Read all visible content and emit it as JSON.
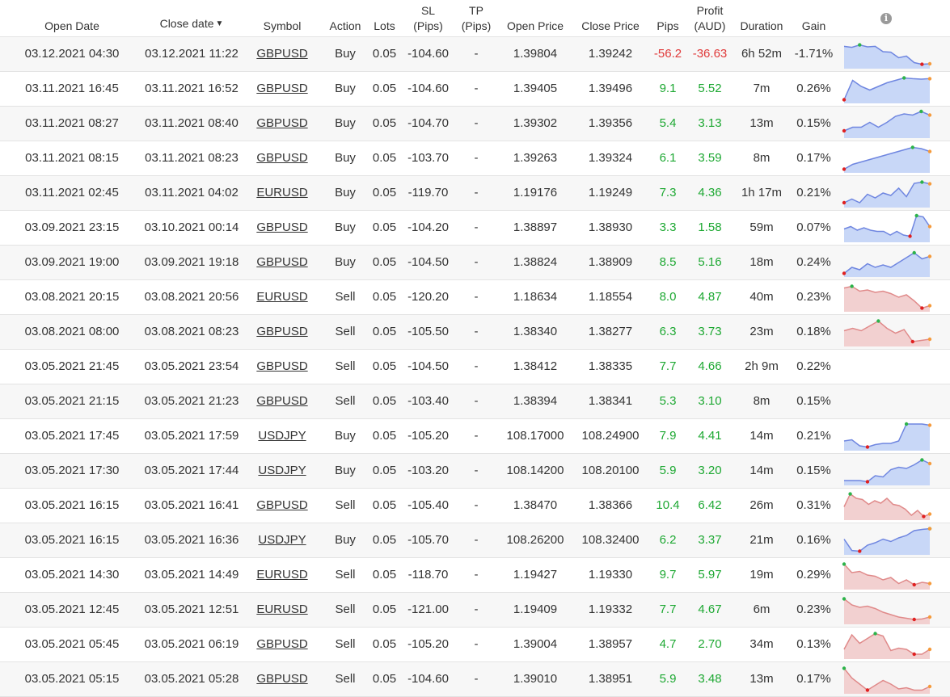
{
  "columns": {
    "open_date": "Open Date",
    "close_date": "Close date",
    "sort_indicator": "▼",
    "symbol": "Symbol",
    "action": "Action",
    "lots": "Lots",
    "sl_1": "SL",
    "sl_2": "(Pips)",
    "tp_1": "TP",
    "tp_2": "(Pips)",
    "open_price": "Open Price",
    "close_price": "Close Price",
    "pips": "Pips",
    "profit_1": "Profit",
    "profit_2": "(AUD)",
    "duration": "Duration",
    "gain": "Gain",
    "info_icon": "i"
  },
  "colors": {
    "positive": "#1da832",
    "negative": "#e03a3a",
    "buy_fill": "#c8d7f7",
    "buy_line": "#6f86e0",
    "sell_fill": "#f2d0d0",
    "sell_line": "#e08a8a",
    "high_dot": "#2cb34a",
    "low_dot": "#e02020",
    "end_dot": "#f59a3b"
  },
  "trades": [
    {
      "open": "03.12.2021 04:30",
      "close": "03.12.2021 11:22",
      "symbol": "GBPUSD",
      "action": "Buy",
      "lots": "0.05",
      "sl": "-104.60",
      "tp": "-",
      "open_price": "1.39804",
      "close_price": "1.39242",
      "pips": "-56.2",
      "profit": "-36.63",
      "duration": "6h 52m",
      "gain": "-1.71%",
      "chart": [
        0.82,
        0.78,
        0.88,
        0.8,
        0.82,
        0.6,
        0.58,
        0.35,
        0.42,
        0.15,
        0.08,
        0.1
      ]
    },
    {
      "open": "03.11.2021 16:45",
      "close": "03.11.2021 16:52",
      "symbol": "GBPUSD",
      "action": "Buy",
      "lots": "0.05",
      "sl": "-104.60",
      "tp": "-",
      "open_price": "1.39405",
      "close_price": "1.39496",
      "pips": "9.1",
      "profit": "5.52",
      "duration": "7m",
      "gain": "0.26%",
      "chart": [
        0.05,
        0.85,
        0.6,
        0.45,
        0.6,
        0.75,
        0.85,
        0.95,
        0.92,
        0.9,
        0.92
      ]
    },
    {
      "open": "03.11.2021 08:27",
      "close": "03.11.2021 08:40",
      "symbol": "GBPUSD",
      "action": "Buy",
      "lots": "0.05",
      "sl": "-104.70",
      "tp": "-",
      "open_price": "1.39302",
      "close_price": "1.39356",
      "pips": "5.4",
      "profit": "3.13",
      "duration": "13m",
      "gain": "0.15%",
      "chart": [
        0.2,
        0.35,
        0.35,
        0.55,
        0.35,
        0.55,
        0.8,
        0.9,
        0.85,
        1.0,
        0.85
      ]
    },
    {
      "open": "03.11.2021 08:15",
      "close": "03.11.2021 08:23",
      "symbol": "GBPUSD",
      "action": "Buy",
      "lots": "0.05",
      "sl": "-103.70",
      "tp": "-",
      "open_price": "1.39263",
      "close_price": "1.39324",
      "pips": "6.1",
      "profit": "3.59",
      "duration": "8m",
      "gain": "0.17%",
      "chart": [
        0.05,
        0.25,
        0.35,
        0.45,
        0.55,
        0.65,
        0.75,
        0.85,
        0.95,
        0.9,
        0.78
      ]
    },
    {
      "open": "03.11.2021 02:45",
      "close": "03.11.2021 04:02",
      "symbol": "EURUSD",
      "action": "Buy",
      "lots": "0.05",
      "sl": "-119.70",
      "tp": "-",
      "open_price": "1.19176",
      "close_price": "1.19249",
      "pips": "7.3",
      "profit": "4.36",
      "duration": "1h 17m",
      "gain": "0.21%",
      "chart": [
        0.1,
        0.25,
        0.1,
        0.45,
        0.3,
        0.5,
        0.4,
        0.7,
        0.35,
        0.9,
        0.95,
        0.88
      ]
    },
    {
      "open": "03.09.2021 23:15",
      "close": "03.10.2021 00:14",
      "symbol": "GBPUSD",
      "action": "Buy",
      "lots": "0.05",
      "sl": "-104.20",
      "tp": "-",
      "open_price": "1.38897",
      "close_price": "1.38930",
      "pips": "3.3",
      "profit": "1.58",
      "duration": "59m",
      "gain": "0.07%",
      "chart": [
        0.45,
        0.55,
        0.4,
        0.5,
        0.4,
        0.35,
        0.35,
        0.2,
        0.35,
        0.2,
        0.15,
        1.0,
        0.95,
        0.55
      ]
    },
    {
      "open": "03.09.2021 19:00",
      "close": "03.09.2021 19:18",
      "symbol": "GBPUSD",
      "action": "Buy",
      "lots": "0.05",
      "sl": "-104.50",
      "tp": "-",
      "open_price": "1.38824",
      "close_price": "1.38909",
      "pips": "8.5",
      "profit": "5.16",
      "duration": "18m",
      "gain": "0.24%",
      "chart": [
        0.05,
        0.3,
        0.2,
        0.45,
        0.3,
        0.4,
        0.3,
        0.5,
        0.7,
        0.9,
        0.65,
        0.75
      ]
    },
    {
      "open": "03.08.2021 20:15",
      "close": "03.08.2021 20:56",
      "symbol": "EURUSD",
      "action": "Sell",
      "lots": "0.05",
      "sl": "-120.20",
      "tp": "-",
      "open_price": "1.18634",
      "close_price": "1.18554",
      "pips": "8.0",
      "profit": "4.87",
      "duration": "40m",
      "gain": "0.23%",
      "chart": [
        0.88,
        0.95,
        0.75,
        0.8,
        0.7,
        0.75,
        0.65,
        0.5,
        0.6,
        0.35,
        0.05,
        0.15
      ]
    },
    {
      "open": "03.08.2021 08:00",
      "close": "03.08.2021 08:23",
      "symbol": "GBPUSD",
      "action": "Sell",
      "lots": "0.05",
      "sl": "-105.50",
      "tp": "-",
      "open_price": "1.38340",
      "close_price": "1.38277",
      "pips": "6.3",
      "profit": "3.73",
      "duration": "23m",
      "gain": "0.18%",
      "chart": [
        0.55,
        0.65,
        0.55,
        0.75,
        0.95,
        0.65,
        0.45,
        0.6,
        0.1,
        0.15,
        0.2
      ]
    },
    {
      "open": "03.05.2021 21:45",
      "close": "03.05.2021 23:54",
      "symbol": "GBPUSD",
      "action": "Sell",
      "lots": "0.05",
      "sl": "-104.50",
      "tp": "-",
      "open_price": "1.38412",
      "close_price": "1.38335",
      "pips": "7.7",
      "profit": "4.66",
      "duration": "2h 9m",
      "gain": "0.22%",
      "chart": []
    },
    {
      "open": "03.05.2021 21:15",
      "close": "03.05.2021 21:23",
      "symbol": "GBPUSD",
      "action": "Sell",
      "lots": "0.05",
      "sl": "-103.40",
      "tp": "-",
      "open_price": "1.38394",
      "close_price": "1.38341",
      "pips": "5.3",
      "profit": "3.10",
      "duration": "8m",
      "gain": "0.15%",
      "chart": []
    },
    {
      "open": "03.05.2021 17:45",
      "close": "03.05.2021 17:59",
      "symbol": "USDJPY",
      "action": "Buy",
      "lots": "0.05",
      "sl": "-105.20",
      "tp": "-",
      "open_price": "108.17000",
      "close_price": "108.24900",
      "pips": "7.9",
      "profit": "4.41",
      "duration": "14m",
      "gain": "0.21%",
      "chart": [
        0.3,
        0.35,
        0.1,
        0.05,
        0.15,
        0.2,
        0.2,
        0.3,
        1.0,
        1.0,
        1.0,
        0.95
      ]
    },
    {
      "open": "03.05.2021 17:30",
      "close": "03.05.2021 17:44",
      "symbol": "USDJPY",
      "action": "Buy",
      "lots": "0.05",
      "sl": "-103.20",
      "tp": "-",
      "open_price": "108.14200",
      "close_price": "108.20100",
      "pips": "5.9",
      "profit": "3.20",
      "duration": "14m",
      "gain": "0.15%",
      "chart": [
        0.1,
        0.1,
        0.1,
        0.05,
        0.3,
        0.25,
        0.55,
        0.65,
        0.6,
        0.75,
        0.95,
        0.8
      ]
    },
    {
      "open": "03.05.2021 16:15",
      "close": "03.05.2021 16:41",
      "symbol": "GBPUSD",
      "action": "Sell",
      "lots": "0.05",
      "sl": "-105.40",
      "tp": "-",
      "open_price": "1.38470",
      "close_price": "1.38366",
      "pips": "10.4",
      "profit": "6.42",
      "duration": "26m",
      "gain": "0.31%",
      "chart": [
        0.45,
        0.98,
        0.8,
        0.75,
        0.55,
        0.7,
        0.6,
        0.8,
        0.55,
        0.5,
        0.35,
        0.1,
        0.3,
        0.05,
        0.15
      ]
    },
    {
      "open": "03.05.2021 16:15",
      "close": "03.05.2021 16:36",
      "symbol": "USDJPY",
      "action": "Buy",
      "lots": "0.05",
      "sl": "-105.70",
      "tp": "-",
      "open_price": "108.26200",
      "close_price": "108.32400",
      "pips": "6.2",
      "profit": "3.37",
      "duration": "21m",
      "gain": "0.16%",
      "chart": [
        0.55,
        0.08,
        0.05,
        0.3,
        0.4,
        0.55,
        0.45,
        0.6,
        0.7,
        0.9,
        0.95,
        0.98
      ]
    },
    {
      "open": "03.05.2021 14:30",
      "close": "03.05.2021 14:49",
      "symbol": "EURUSD",
      "action": "Sell",
      "lots": "0.05",
      "sl": "-118.70",
      "tp": "-",
      "open_price": "1.19427",
      "close_price": "1.19330",
      "pips": "9.7",
      "profit": "5.97",
      "duration": "19m",
      "gain": "0.29%",
      "chart": [
        0.95,
        0.6,
        0.65,
        0.5,
        0.45,
        0.3,
        0.4,
        0.15,
        0.3,
        0.1,
        0.2,
        0.15
      ]
    },
    {
      "open": "03.05.2021 12:45",
      "close": "03.05.2021 12:51",
      "symbol": "EURUSD",
      "action": "Sell",
      "lots": "0.05",
      "sl": "-121.00",
      "tp": "-",
      "open_price": "1.19409",
      "close_price": "1.19332",
      "pips": "7.7",
      "profit": "4.67",
      "duration": "6m",
      "gain": "0.23%",
      "chart": [
        0.95,
        0.7,
        0.6,
        0.65,
        0.55,
        0.4,
        0.3,
        0.2,
        0.15,
        0.1,
        0.12,
        0.2
      ]
    },
    {
      "open": "03.05.2021 05:45",
      "close": "03.05.2021 06:19",
      "symbol": "GBPUSD",
      "action": "Sell",
      "lots": "0.05",
      "sl": "-105.20",
      "tp": "-",
      "open_price": "1.39004",
      "close_price": "1.38957",
      "pips": "4.7",
      "profit": "2.70",
      "duration": "34m",
      "gain": "0.13%",
      "chart": [
        0.3,
        0.9,
        0.55,
        0.75,
        0.95,
        0.85,
        0.25,
        0.35,
        0.3,
        0.1,
        0.1,
        0.3
      ]
    },
    {
      "open": "03.05.2021 05:15",
      "close": "03.05.2021 05:28",
      "symbol": "GBPUSD",
      "action": "Sell",
      "lots": "0.05",
      "sl": "-104.60",
      "tp": "-",
      "open_price": "1.39010",
      "close_price": "1.38951",
      "pips": "5.9",
      "profit": "3.48",
      "duration": "13m",
      "gain": "0.17%",
      "chart": [
        0.95,
        0.55,
        0.3,
        0.05,
        0.25,
        0.45,
        0.3,
        0.1,
        0.15,
        0.05,
        0.05,
        0.2
      ]
    }
  ]
}
